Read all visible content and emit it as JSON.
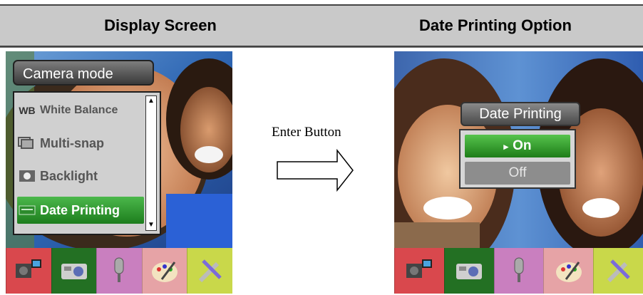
{
  "header": {
    "left_title": "Display Screen",
    "right_title": "Date Printing Option"
  },
  "left_screen": {
    "menu_title": "Camera mode",
    "items": [
      {
        "icon_text": "WB",
        "label": "White Balance"
      },
      {
        "icon_text": "",
        "label": "Multi-snap"
      },
      {
        "icon_text": "",
        "label": "Backlight"
      },
      {
        "icon_text": "",
        "label": "Date Printing"
      }
    ],
    "selected_index": 3
  },
  "arrow": {
    "label": "Enter Button"
  },
  "right_screen": {
    "dialog_title": "Date Printing",
    "options": [
      "On",
      "Off"
    ],
    "selected_marker": "▸",
    "selected_index": 0
  },
  "iconbar": {
    "icons": [
      "video-camera-icon",
      "still-camera-icon",
      "microphone-icon",
      "palette-icon",
      "tools-icon"
    ],
    "colors": [
      "#d84a4a",
      "#2f7a2f",
      "#c97fbf",
      "#e6a3a6",
      "#b9cc44"
    ]
  }
}
